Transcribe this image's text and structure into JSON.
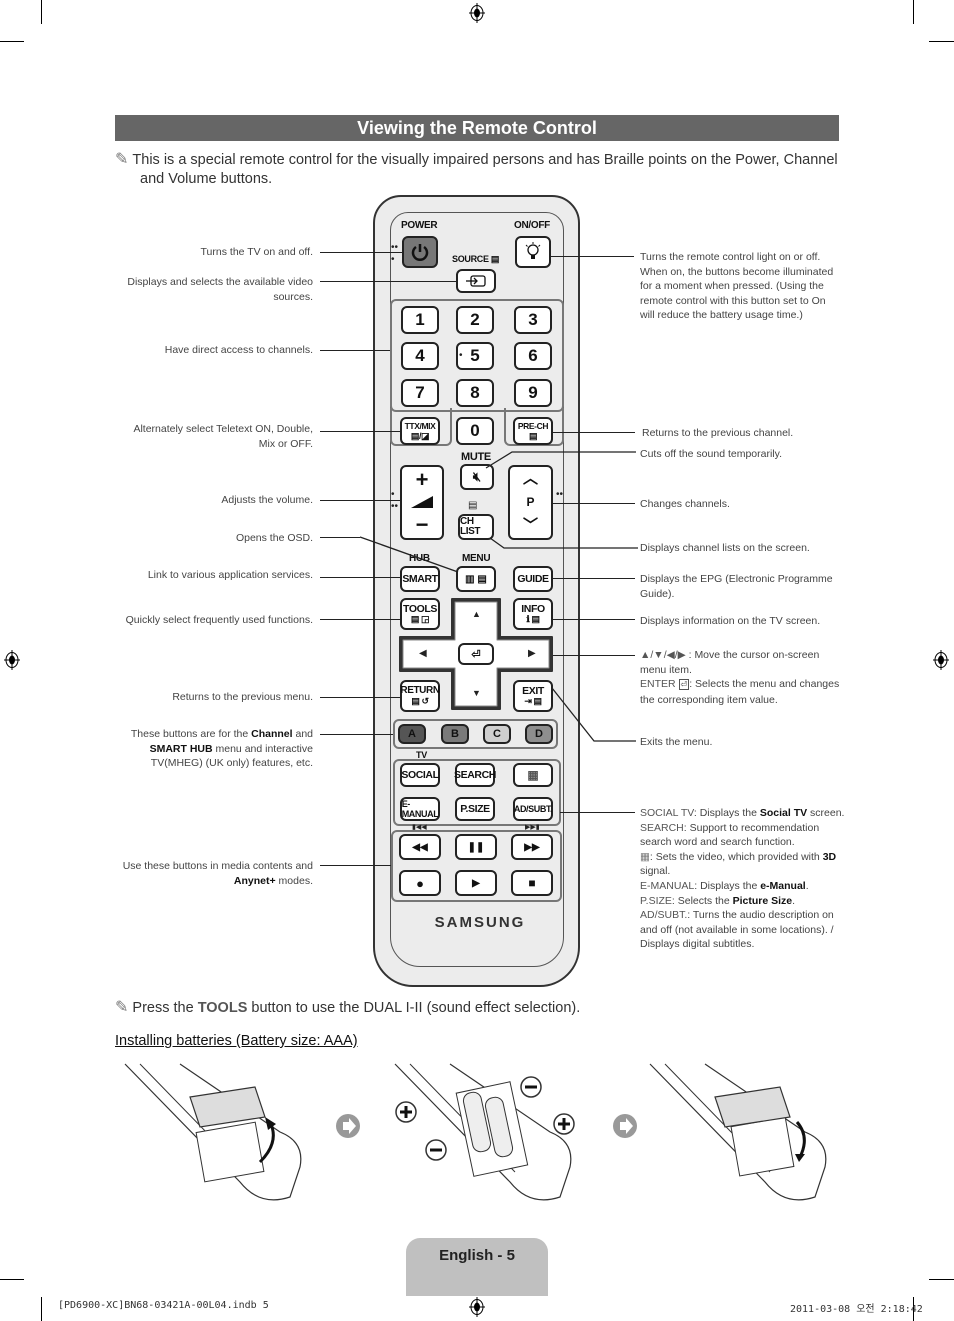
{
  "page": {
    "title": "Viewing the Remote Control",
    "intro_note": "This is a special remote control for the visually impaired persons and has Braille points on the Power, Channel and Volume buttons.",
    "tools_note": {
      "pre": "Press the ",
      "key": "TOOLS",
      "post": " button to use the DUAL I-II (sound effect selection)."
    },
    "battery_heading": "Installing batteries (Battery size: AAA)",
    "page_label": "English - 5",
    "footer_left": "[PD6900-XC]BN68-03421A-00L04.indb   5",
    "footer_right": "2011-03-08   오전 2:18:42"
  },
  "remote": {
    "labels": {
      "power": "POWER",
      "onoff": "ON/OFF",
      "source": "SOURCE",
      "mute": "MUTE",
      "hub": "HUB",
      "menu": "MENU",
      "tv": "TV",
      "p": "P",
      "brand": "SAMSUNG"
    },
    "numbers": [
      "1",
      "2",
      "3",
      "4",
      "5",
      "6",
      "7",
      "8",
      "9",
      "0"
    ],
    "buttons": {
      "ttx": "TTX/MIX",
      "prech": "PRE-CH",
      "chlist": "CH LIST",
      "smart": "SMART",
      "guide": "GUIDE",
      "tools": "TOOLS",
      "info": "INFO",
      "return": "RETURN",
      "exit": "EXIT",
      "social": "SOCIAL",
      "search": "SEARCH",
      "emanual": "E-MANUAL",
      "psize": "P.SIZE",
      "adsubt": "AD/SUBT."
    },
    "color_buttons": [
      {
        "label": "A",
        "color": "#555555"
      },
      {
        "label": "B",
        "color": "#7a7a7a"
      },
      {
        "label": "C",
        "color": "#cfcfcf"
      },
      {
        "label": "D",
        "color": "#8e8e8e"
      }
    ],
    "media_icons": [
      "rewind-icon",
      "pause-icon",
      "fast-forward-icon",
      "record-icon",
      "play-icon",
      "stop-icon"
    ],
    "media_glyphs": [
      "◀◀",
      "❚❚",
      "▶▶",
      "●",
      "▶",
      "■"
    ]
  },
  "callouts_left": [
    "Turns the TV on and off.",
    "Displays and selects the available video sources.",
    "Have direct access to channels.",
    "Alternately select Teletext ON, Double, Mix or OFF.",
    "Adjusts the volume.",
    "Opens the OSD.",
    "Link to various application services.",
    "Quickly select frequently used functions.",
    "Returns to the previous menu."
  ],
  "callout_color": {
    "pre": "These buttons are for the ",
    "b1": "Channel",
    "mid": " and ",
    "b2": "SMART HUB",
    "post": " menu and interactive TV(MHEG) (UK only) features, etc."
  },
  "callout_media": {
    "pre": "Use these buttons in media contents and ",
    "b": "Anynet+",
    "post": " modes."
  },
  "callouts_right": [
    "Turns the remote control light on or off. When on, the buttons become illuminated for a moment when pressed. (Using the remote control with this button set to On will reduce the battery usage time.)",
    "Returns to the previous channel.",
    "Cuts off the sound temporarily.",
    "Changes channels.",
    "Displays channel lists on the screen.",
    "Displays the EPG (Electronic Programme Guide).",
    "Displays information on the TV screen.",
    "Exits the menu."
  ],
  "callout_nav": {
    "arrows": "▲/▼/◀/▶",
    "arrows_text": " : Move the cursor on-screen menu item.",
    "enter_key": "ENTER",
    "enter_text": ": Selects the menu and changes the corresponding item value."
  },
  "callout_bottom_right": {
    "social_key": "SOCIAL TV",
    "social_text": ": Displays the ",
    "social_b": "Social TV",
    "social_end": " screen.",
    "search_key": "SEARCH",
    "search_text": ": Support to recommendation search word and search function.",
    "threed_text": ": Sets the video, which provided with ",
    "threed_b": "3D",
    "threed_end": " signal.",
    "emanual_key": "E-MANUAL",
    "emanual_text": ": Displays the ",
    "emanual_b": "e-Manual",
    "emanual_end": ".",
    "psize_key": "P.SIZE",
    "psize_text": ": Selects the ",
    "psize_b": "Picture Size",
    "psize_end": ".",
    "adsubt_key": "AD/SUBT.",
    "adsubt_text": ": Turns the audio description on and off (not available in some locations). / Displays digital subtitles."
  }
}
